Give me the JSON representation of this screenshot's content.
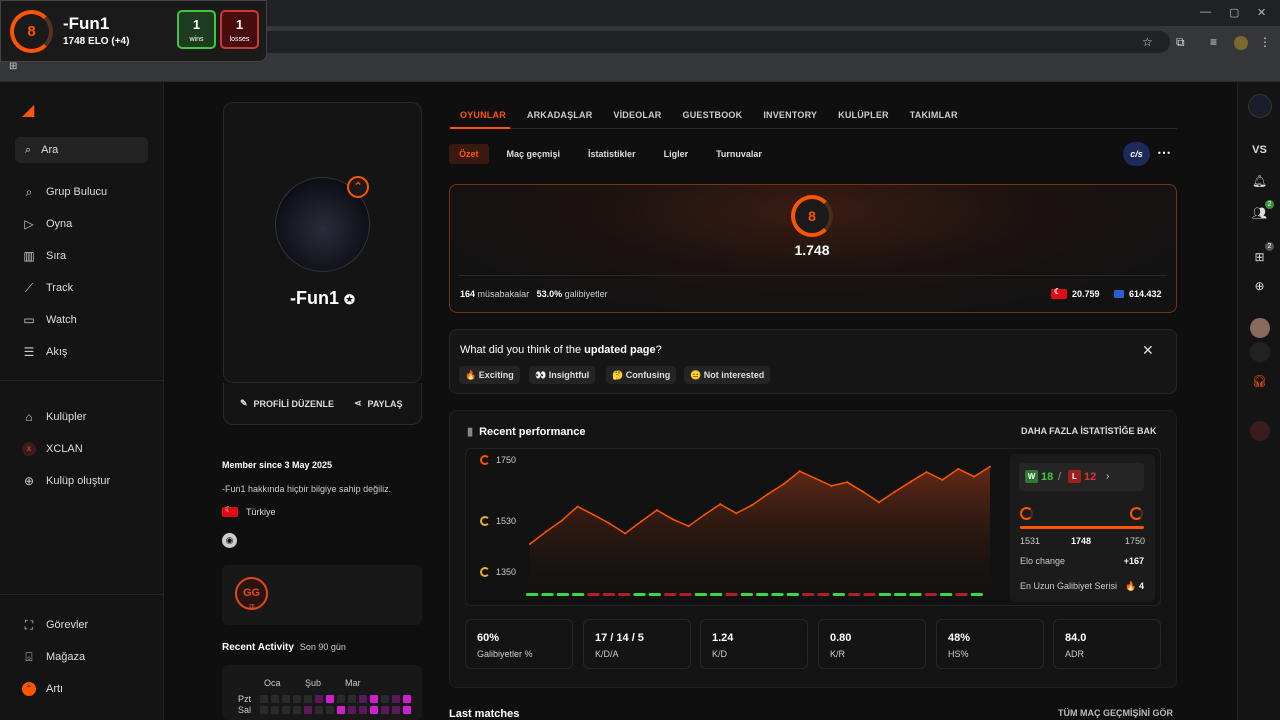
{
  "overlay": {
    "level": "8",
    "name": "-Fun1",
    "elo_line": "1748 ELO (+4)",
    "wins": "1",
    "wins_label": "wins",
    "losses": "1",
    "losses_label": "losses"
  },
  "sidebar": {
    "search": "Ara",
    "items": [
      {
        "label": "Grup Bulucu",
        "icon": "group-finder-icon"
      },
      {
        "label": "Oyna",
        "icon": "play-icon"
      },
      {
        "label": "Sıra",
        "icon": "ranking-icon"
      },
      {
        "label": "Track",
        "icon": "track-icon"
      },
      {
        "label": "Watch",
        "icon": "watch-icon"
      },
      {
        "label": "Akış",
        "icon": "feed-icon"
      }
    ],
    "clubs": [
      {
        "label": "Kulüpler",
        "icon": "clubs-icon"
      },
      {
        "label": "XCLAN",
        "icon": "xclan-icon"
      },
      {
        "label": "Kulüp oluştur",
        "icon": "plus-icon"
      }
    ],
    "bottom": [
      {
        "label": "Görevler",
        "icon": "missions-icon"
      },
      {
        "label": "Mağaza",
        "icon": "shop-icon"
      },
      {
        "label": "Artı",
        "icon": "plus-sub-icon"
      }
    ]
  },
  "right_sidebar": {
    "vs": "VS",
    "friends_count": "2",
    "party_count": "2"
  },
  "profile": {
    "name": "-Fun1",
    "edit": "PROFİLİ DÜZENLE",
    "share": "PAYLAŞ",
    "member_since": "Member since 3 May 2025",
    "bio": "-Fun1 hakkında hiçbir bilgiye sahip değiliz.",
    "country": "Türkiye",
    "badge": "GG",
    "badge_sub": "25",
    "recent_activity": "Recent Activity",
    "recent_range": "Son 90 gün",
    "months": [
      "Oca",
      "Şub",
      "Mar"
    ],
    "days": [
      "Pzt",
      "Sal"
    ]
  },
  "tabs": [
    "OYUNLAR",
    "ARKADAŞLAR",
    "VİDEOLAR",
    "GUESTBOOK",
    "INVENTORY",
    "KULÜPLER",
    "TAKIMLAR"
  ],
  "subtabs": [
    "Özet",
    "Maç geçmişi",
    "İstatistikler",
    "Ligler",
    "Turnuvalar"
  ],
  "game_badge": "c/s",
  "elo_card": {
    "level": "8",
    "elo": "1.748",
    "matches": "164",
    "matches_label": "müsabakalar",
    "winrate": "53.0%",
    "winrate_label": "galibiyetler",
    "country_rank": "20.759",
    "region_rank": "614.432"
  },
  "feedback": {
    "question_prefix": "What did you think of the",
    "question_bold": "updated page",
    "question_suffix": "?",
    "chips": [
      "🔥 Exciting",
      "👀 Insightful",
      "🤔 Confusing",
      "😐 Not interested"
    ]
  },
  "performance": {
    "title": "Recent performance",
    "more": "DAHA FAZLA İSTATİSTİĞE BAK",
    "y_labels": [
      "1750",
      "1530",
      "1350"
    ],
    "wins": "18",
    "losses": "12",
    "range_low": "1531",
    "range_current": "1748",
    "range_high": "1750",
    "elo_change_label": "Elo change",
    "elo_change": "+167",
    "streak_label": "En Uzun Galibiyet Serisi",
    "streak": "🔥 4"
  },
  "chart_data": {
    "type": "area",
    "title": "Recent performance",
    "xlabel": "",
    "ylabel": "",
    "ylim": [
      1350,
      1800
    ],
    "y_ticks": [
      1750,
      1530,
      1350
    ],
    "values": [
      1581,
      1608,
      1632,
      1663,
      1645,
      1626,
      1604,
      1630,
      1655,
      1635,
      1620,
      1645,
      1668,
      1648,
      1666,
      1690,
      1712,
      1740,
      1724,
      1708,
      1716,
      1695,
      1672,
      1695,
      1717,
      1738,
      1721,
      1745,
      1728,
      1750
    ],
    "results": [
      "W",
      "W",
      "W",
      "W",
      "L",
      "L",
      "L",
      "W",
      "W",
      "L",
      "L",
      "W",
      "W",
      "L",
      "W",
      "W",
      "W",
      "W",
      "L",
      "L",
      "W",
      "L",
      "L",
      "W",
      "W",
      "W",
      "L",
      "W",
      "L",
      "W"
    ]
  },
  "kpis": [
    {
      "value": "60%",
      "label": "Galibiyetler %"
    },
    {
      "value": "17 / 14 / 5",
      "label": "K/D/A"
    },
    {
      "value": "1.24",
      "label": "K/D"
    },
    {
      "value": "0.80",
      "label": "K/R"
    },
    {
      "value": "48%",
      "label": "HS%"
    },
    {
      "value": "84.0",
      "label": "ADR"
    }
  ],
  "last_matches": "Last matches",
  "all_matches": "TÜM MAÇ GEÇMİŞİNİ GÖR"
}
